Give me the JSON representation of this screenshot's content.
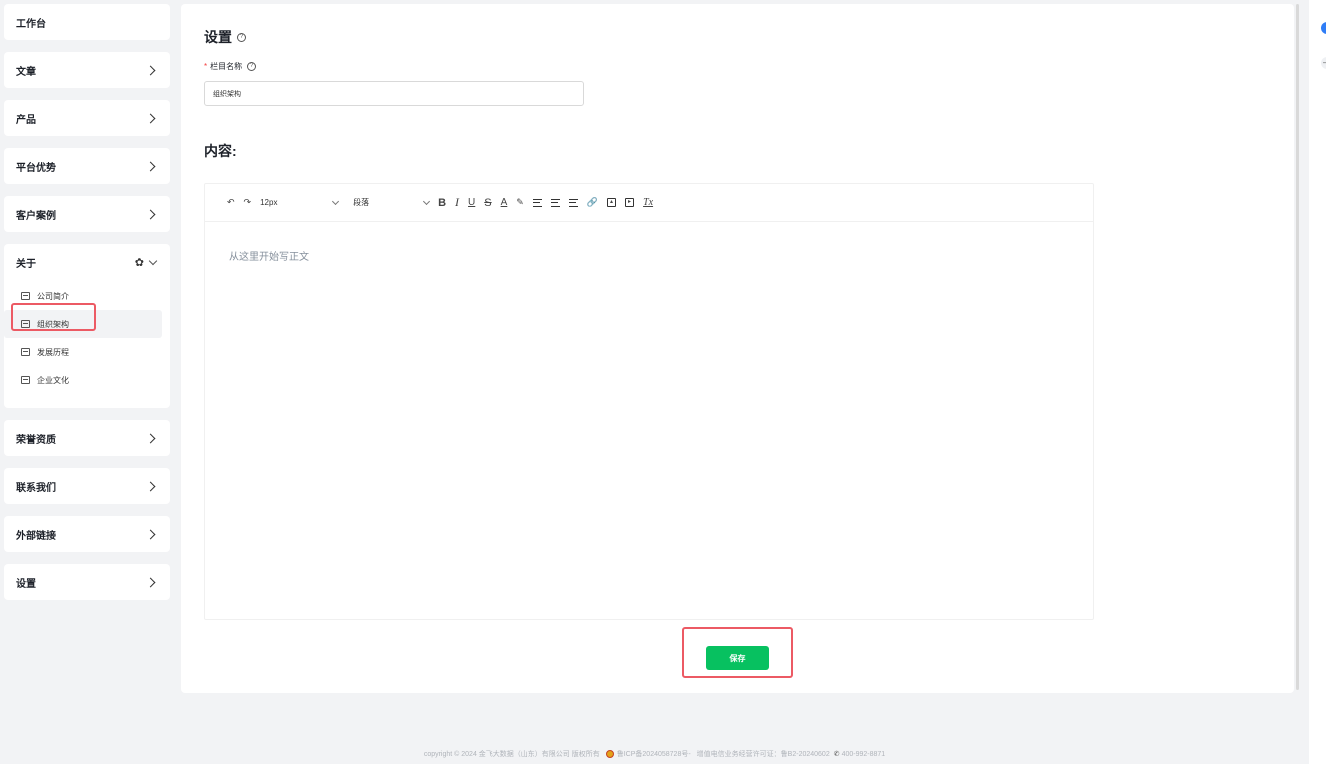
{
  "sidebar": {
    "items": [
      {
        "label": "工作台"
      },
      {
        "label": "文章"
      },
      {
        "label": "产品"
      },
      {
        "label": "平台优势"
      },
      {
        "label": "客户案例"
      },
      {
        "label": "关于",
        "children": [
          "公司简介",
          "组织架构",
          "发展历程",
          "企业文化"
        ],
        "active_child": "组织架构"
      },
      {
        "label": "荣誉资质"
      },
      {
        "label": "联系我们"
      },
      {
        "label": "外部链接"
      },
      {
        "label": "设置"
      }
    ]
  },
  "main": {
    "title": "设置",
    "field_label": "栏目名称",
    "required_mark": "*",
    "field_value": "组织架构",
    "content_title": "内容:",
    "editor": {
      "font_size": "12px",
      "block_type": "段落",
      "placeholder": "从这里开始写正文",
      "tools": {
        "bold": "B",
        "italic": "I",
        "underline": "U",
        "strike": "S",
        "font_color": "A",
        "clear": "Tx"
      }
    },
    "save_label": "保存"
  },
  "footer": {
    "text1": "copyright © 2024 金飞大数据（山东）有限公司 版权所有",
    "icp": "鲁ICP备2024058728号-",
    "license": "增值电信业务经营许可证：鲁B2-20240602",
    "phone": "400-992-8871"
  },
  "colors": {
    "accent": "#07c160",
    "highlight": "#ec5a64",
    "required": "#f53f3f"
  }
}
